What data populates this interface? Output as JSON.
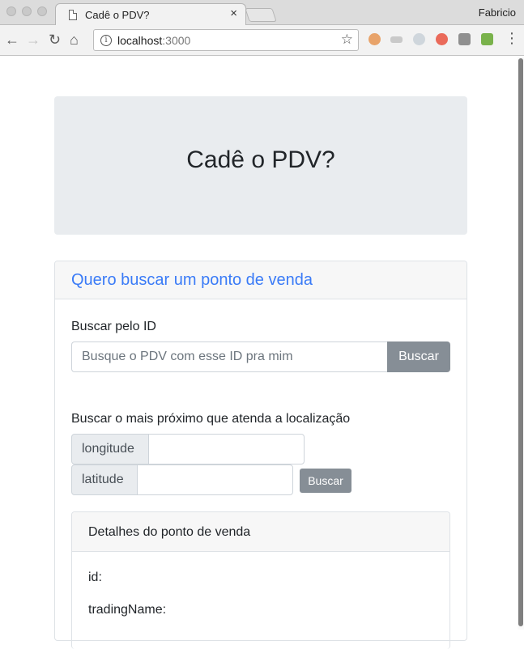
{
  "browser": {
    "tab_title": "Cadê o PDV?",
    "tab_close": "×",
    "profile_name": "Fabricio",
    "url_host": "localhost",
    "url_port": ":3000",
    "extensions": [
      "hand-extension-icon",
      "glasses-extension-icon",
      "skype-extension-icon",
      "refresh-extension-icon",
      "bulb-extension-icon",
      "cors-extension-icon"
    ]
  },
  "page": {
    "title": "Cadê o PDV?",
    "card_header": "Quero buscar um ponto de venda",
    "search_id": {
      "label": "Buscar pelo ID",
      "placeholder": "Busque o PDV com esse ID pra mim",
      "value": "",
      "button": "Buscar"
    },
    "search_location": {
      "label": "Buscar o mais próximo que atenda a localização",
      "longitude_label": "longitude",
      "longitude_value": "",
      "latitude_label": "latitude",
      "latitude_value": "",
      "button": "Buscar"
    },
    "details": {
      "header": "Detalhes do ponto de venda",
      "fields": [
        "id:",
        "tradingName:"
      ]
    }
  }
}
